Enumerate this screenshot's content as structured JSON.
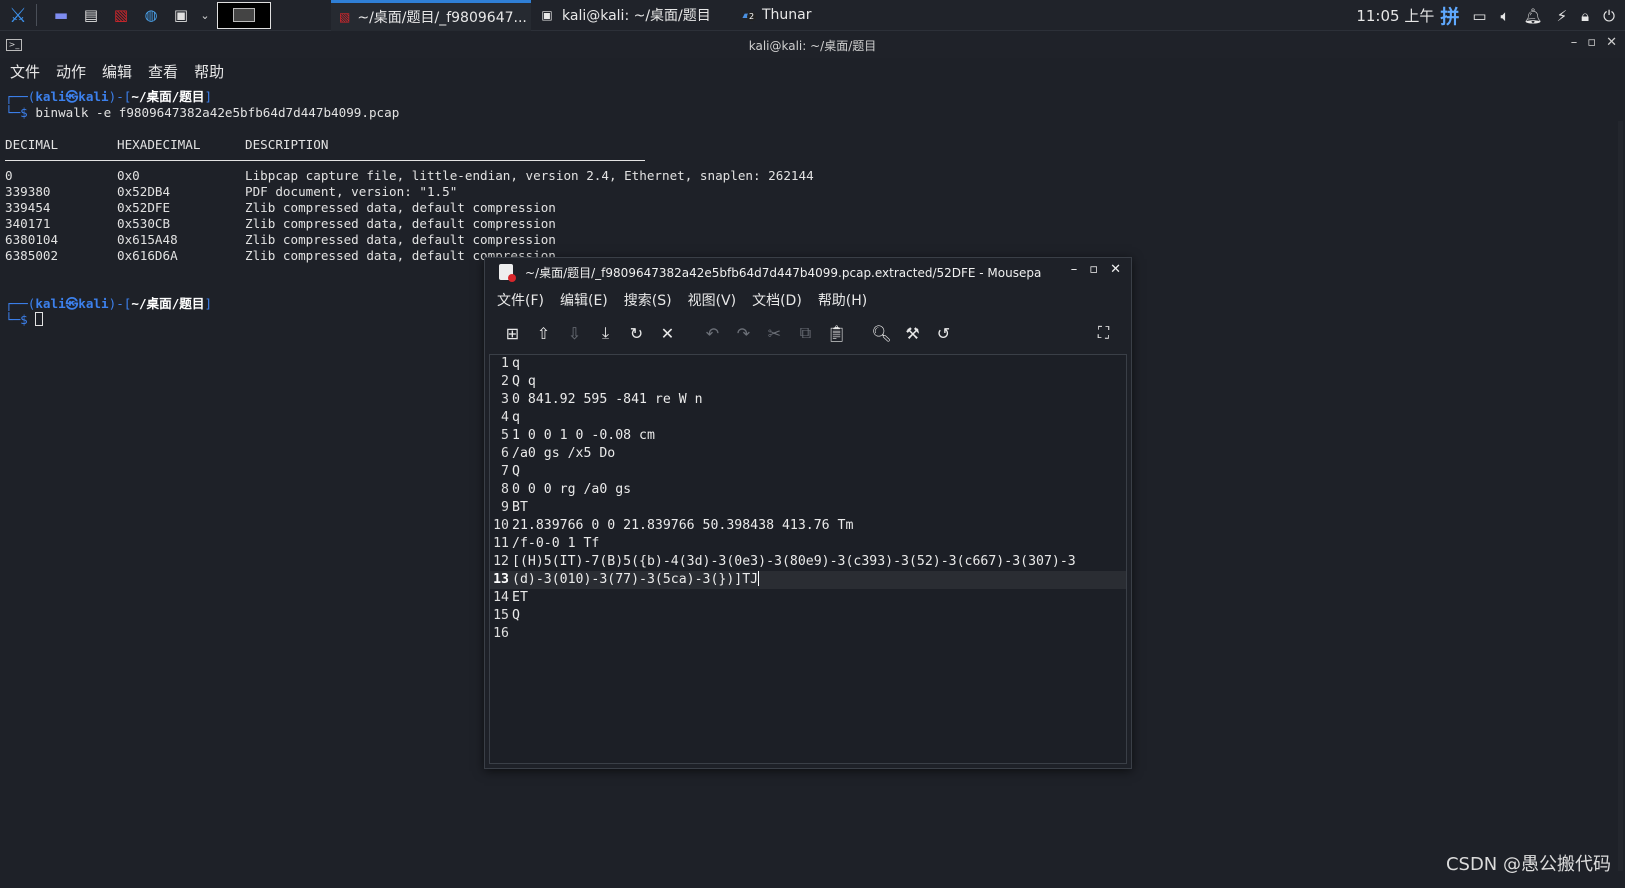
{
  "taskbar": {
    "tasks": [
      {
        "label": "~/桌面/题目/_f9809647...",
        "icon": "mousepad-icon"
      },
      {
        "label": "kali@kali: ~/桌面/题目",
        "icon": "terminal-icon"
      },
      {
        "label": "Thunar",
        "icon": "folder-icon"
      }
    ],
    "thunar_badge": "2",
    "clock": "11:05 上午",
    "ime": "拼"
  },
  "terminal": {
    "title": "kali@kali: ~/桌面/题目",
    "menu": [
      "文件",
      "动作",
      "编辑",
      "查看",
      "帮助"
    ],
    "prompt": {
      "open": "┌──(",
      "user": "kali㉿kali",
      "mid": ")-[",
      "path": "~/桌面/题目",
      "close": "]",
      "dollar": "└─$ "
    },
    "command": "binwalk -e f9809647382a42e5bfb64d7d447b4099.pcap",
    "headers": [
      "DECIMAL",
      "HEXADECIMAL",
      "DESCRIPTION"
    ],
    "rows": [
      [
        "0",
        "0x0",
        "Libpcap capture file, little-endian, version 2.4, Ethernet, snaplen: 262144"
      ],
      [
        "339380",
        "0x52DB4",
        "PDF document, version: \"1.5\""
      ],
      [
        "339454",
        "0x52DFE",
        "Zlib compressed data, default compression"
      ],
      [
        "340171",
        "0x530CB",
        "Zlib compressed data, default compression"
      ],
      [
        "6380104",
        "0x615A48",
        "Zlib compressed data, default compression"
      ],
      [
        "6385002",
        "0x616D6A",
        "Zlib compressed data, default compression"
      ]
    ]
  },
  "mousepad": {
    "title": "~/桌面/题目/_f9809647382a42e5bfb64d7d447b4099.pcap.extracted/52DFE - Mousepad",
    "menu": [
      "文件(F)",
      "编辑(E)",
      "搜索(S)",
      "视图(V)",
      "文档(D)",
      "帮助(H)"
    ],
    "lines": [
      "q",
      "Q q",
      "0 841.92 595 -841 re W n",
      "q",
      "1 0 0 1 0 -0.08 cm",
      "/a0 gs /x5 Do",
      "Q",
      "0 0 0 rg /a0 gs",
      "BT",
      "21.839766 0 0 21.839766 50.398438 413.76 Tm",
      "/f-0-0 1 Tf",
      "[(H)5(IT)-7(B)5({b)-4(3d)-3(0e3)-3(80e9)-3(c393)-3(52)-3(c667)-3(307)-3",
      "(d)-3(010)-3(77)-3(5ca)-3(})]TJ",
      "ET",
      "Q",
      ""
    ],
    "line_numbers": [
      "1",
      "2",
      "3",
      "4",
      "5",
      "6",
      "7",
      "8",
      "9",
      "10",
      "11",
      "12",
      "13",
      "14",
      "15",
      "16"
    ]
  },
  "watermark": "CSDN @愚公搬代码"
}
